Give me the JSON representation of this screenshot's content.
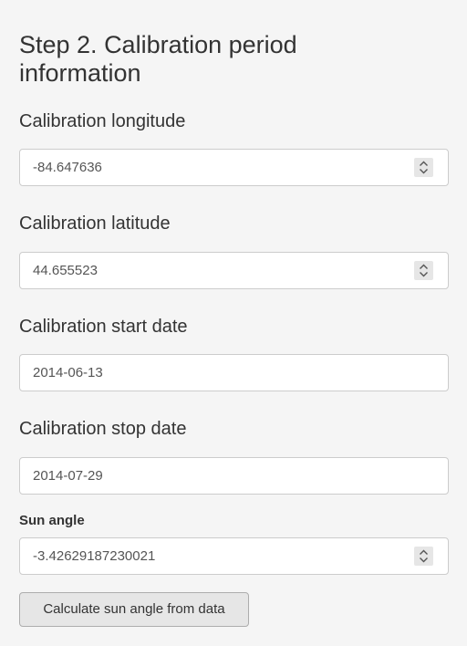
{
  "step": {
    "title": "Step 2. Calibration period information"
  },
  "fields": {
    "longitude": {
      "label": "Calibration longitude",
      "value": "-84.647636"
    },
    "latitude": {
      "label": "Calibration latitude",
      "value": "44.655523"
    },
    "start_date": {
      "label": "Calibration start date",
      "value": "2014-06-13"
    },
    "stop_date": {
      "label": "Calibration stop date",
      "value": "2014-07-29"
    },
    "sun_angle": {
      "label": "Sun angle",
      "value": "-3.42629187230021"
    }
  },
  "actions": {
    "calculate_label": "Calculate sun angle from data"
  },
  "icons": {
    "spinner": "stepper-arrows-icon"
  },
  "colors": {
    "background": "#f5f5f5",
    "input_border": "#cccccc",
    "button_bg": "#e6e6e6",
    "text": "#333333"
  }
}
